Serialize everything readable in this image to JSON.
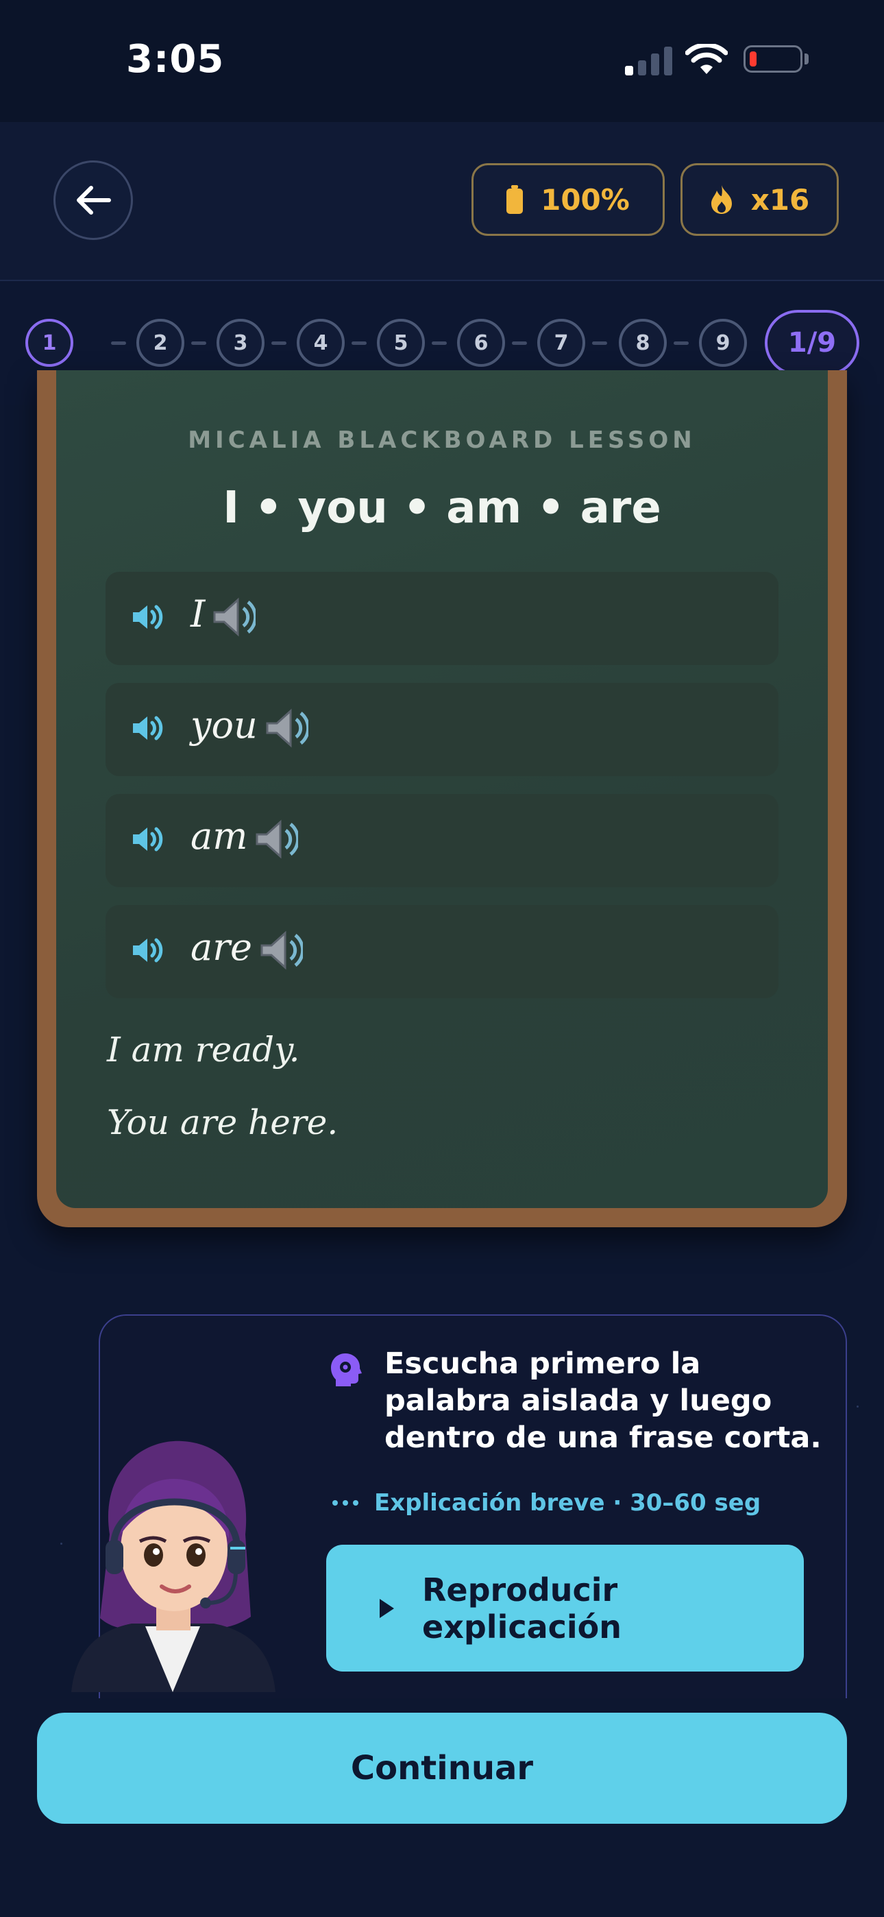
{
  "status_bar": {
    "time": "3:05"
  },
  "header": {
    "energy": "100%",
    "streak": "x16"
  },
  "progress": {
    "steps": [
      "1",
      "2",
      "3",
      "4",
      "5",
      "6",
      "7",
      "8",
      "9"
    ],
    "current_step": 1,
    "counter": "1/9"
  },
  "lesson": {
    "label": "MICALIA BLACKBOARD LESSON",
    "title": "I • you • am • are",
    "words": [
      {
        "text": "I"
      },
      {
        "text": "you"
      },
      {
        "text": "am"
      },
      {
        "text": "are"
      }
    ],
    "sentences": [
      "I am ready.",
      "You are here."
    ]
  },
  "tutor": {
    "tip": "Escucha primero la palabra aislada y luego dentro de una frase corta.",
    "hint": "Explicación breve · 30–60 seg",
    "play_label": "Reproducir explicación"
  },
  "footer": {
    "continue_label": "Continuar"
  },
  "colors": {
    "accent": "#5fd0ea",
    "active_step": "#8a6cf0",
    "gold": "#f2b63c",
    "board": "#2f4a41",
    "frame": "#8b5e3c"
  }
}
